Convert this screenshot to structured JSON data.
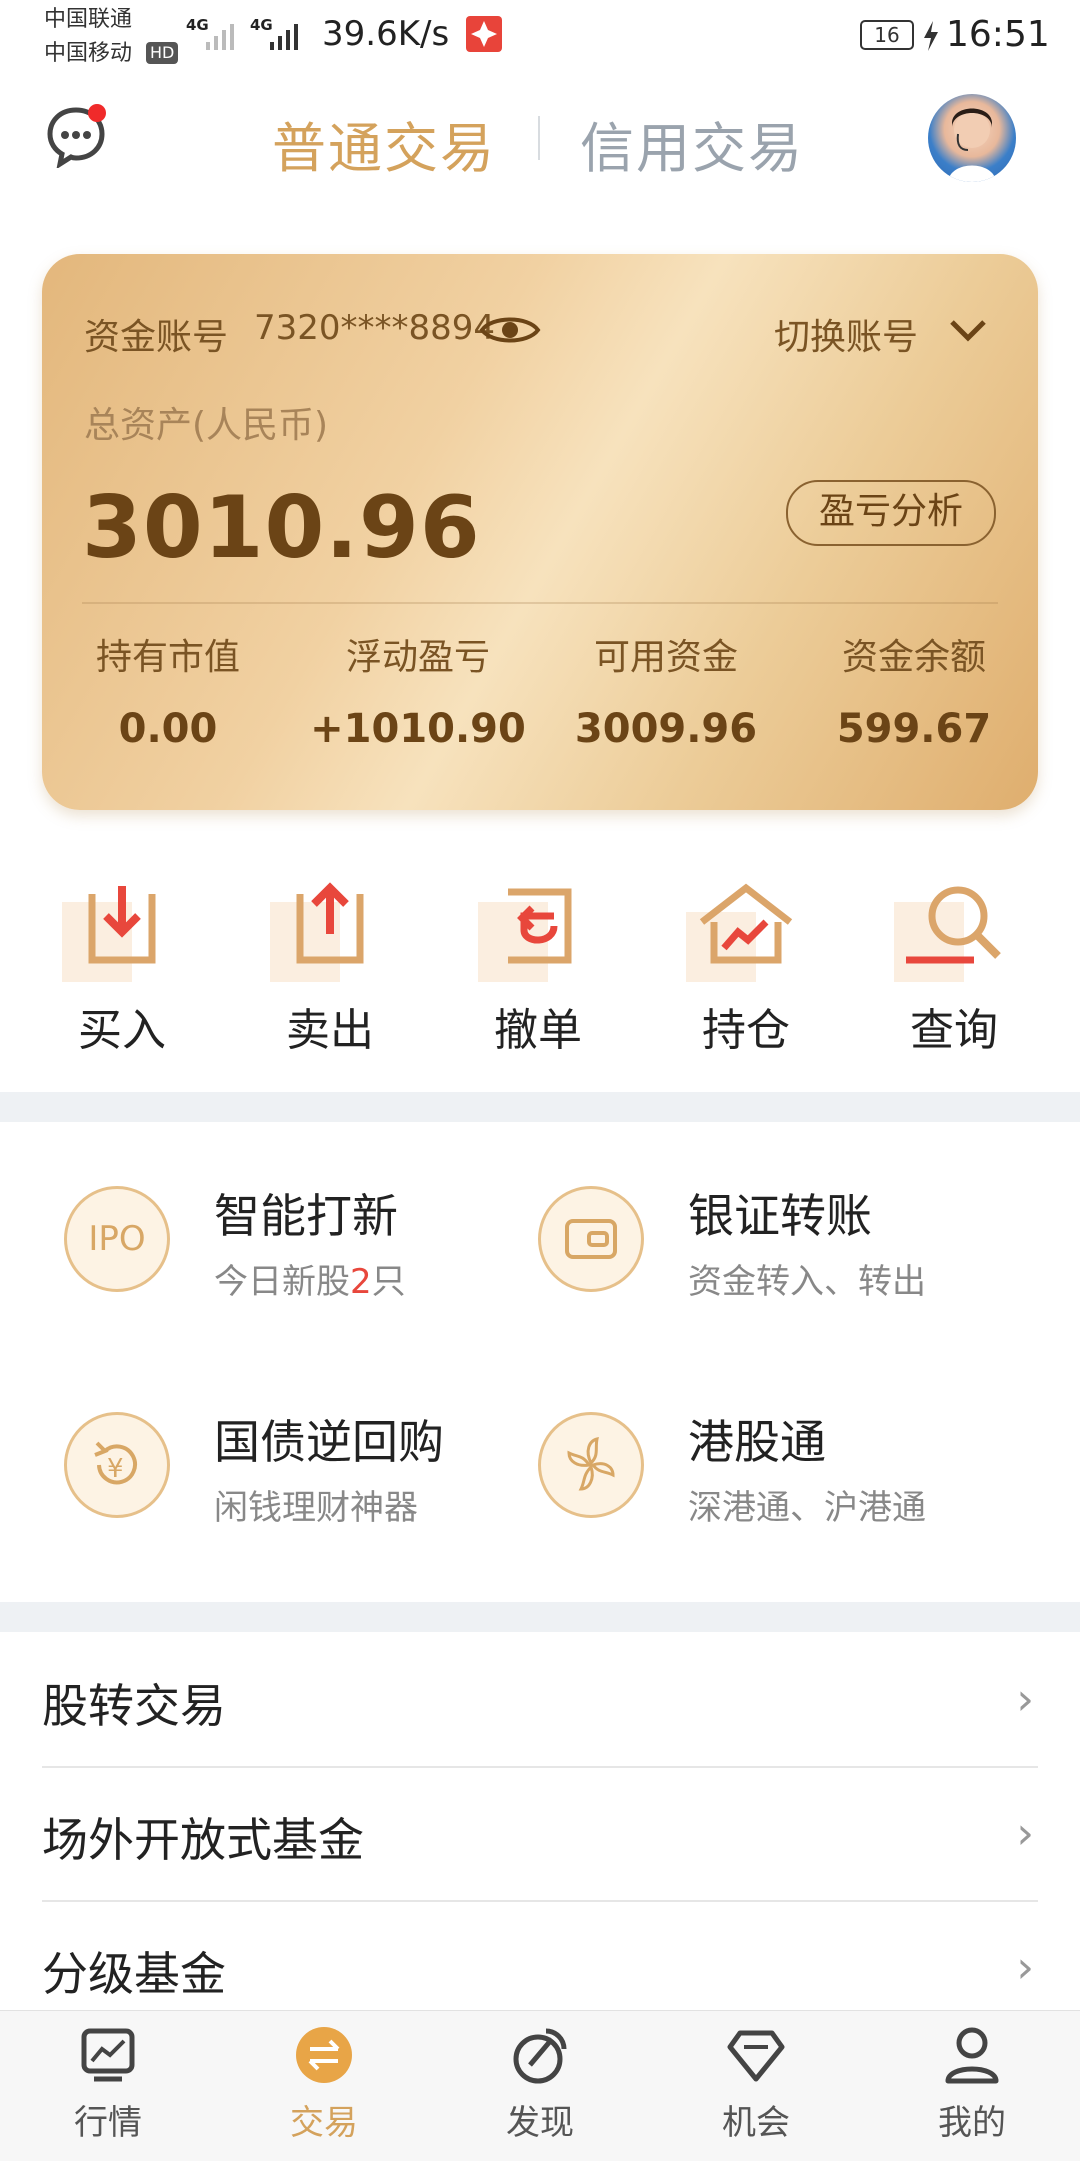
{
  "status_bar": {
    "carrier1": "中国联通",
    "carrier2": "中国移动",
    "hd": "HD",
    "net1": "4G",
    "net2": "4G",
    "speed": "39.6K/s",
    "battery": "16",
    "time": "16:51"
  },
  "header": {
    "tab_normal": "普通交易",
    "tab_credit": "信用交易",
    "active_color": "#d4a25c",
    "inactive_color": "#9aa3ad"
  },
  "account": {
    "label": "资金账号",
    "number": "7320****8894",
    "switch_label": "切换账号",
    "total_label": "总资产(人民币)",
    "total_value": "3010.96",
    "analysis_button": "盈亏分析",
    "stats": [
      {
        "label": "持有市值",
        "value": "0.00"
      },
      {
        "label": "浮动盈亏",
        "value": "+1010.90"
      },
      {
        "label": "可用资金",
        "value": "3009.96"
      },
      {
        "label": "资金余额",
        "value": "599.67"
      }
    ]
  },
  "actions": [
    {
      "label": "买入",
      "icon": "buy-icon"
    },
    {
      "label": "卖出",
      "icon": "sell-icon"
    },
    {
      "label": "撤单",
      "icon": "cancel-order-icon"
    },
    {
      "label": "持仓",
      "icon": "position-icon"
    },
    {
      "label": "查询",
      "icon": "query-icon"
    }
  ],
  "features": [
    {
      "title": "智能打新",
      "sub_prefix": "今日新股",
      "sub_highlight": "2",
      "sub_suffix": "只",
      "icon_text": "IPO",
      "icon": "ipo-icon"
    },
    {
      "title": "银证转账",
      "sub": "资金转入、转出",
      "icon": "wallet-icon"
    },
    {
      "title": "国债逆回购",
      "sub": "闲钱理财神器",
      "icon": "yuan-cycle-icon"
    },
    {
      "title": "港股通",
      "sub": "深港通、沪港通",
      "icon": "bauhinia-icon"
    }
  ],
  "list": [
    {
      "label": "股转交易"
    },
    {
      "label": "场外开放式基金"
    },
    {
      "label": "分级基金"
    }
  ],
  "bottom_nav": [
    {
      "label": "行情",
      "icon": "chart-icon",
      "active": false
    },
    {
      "label": "交易",
      "icon": "trade-icon",
      "active": true
    },
    {
      "label": "发现",
      "icon": "discover-icon",
      "active": false
    },
    {
      "label": "机会",
      "icon": "diamond-icon",
      "active": false
    },
    {
      "label": "我的",
      "icon": "user-icon",
      "active": false
    }
  ]
}
